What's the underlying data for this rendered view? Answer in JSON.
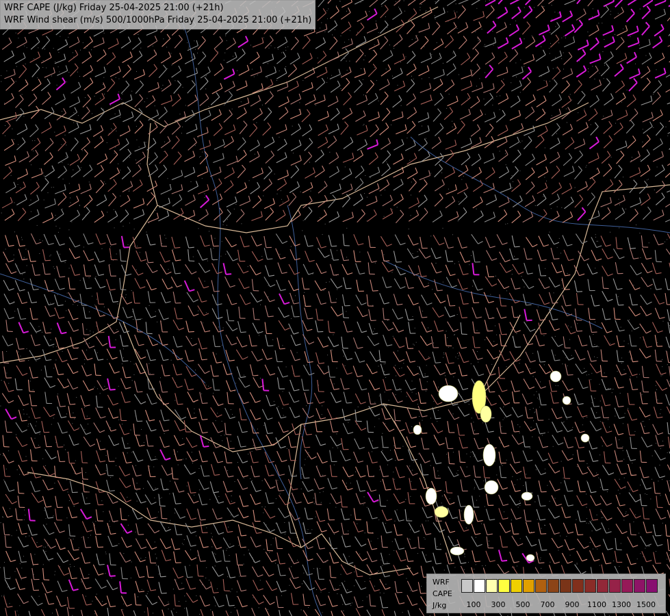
{
  "title": {
    "line1": "WRF CAPE (J/kg) Friday 25-04-2025 21:00 (+21h)",
    "line2": "WRF Wind shear (m/s) 500/1000hPa Friday 25-04-2025 21:00 (+21h)"
  },
  "legend": {
    "label_line1": "WRF",
    "label_line2": "CAPE",
    "label_line3": "J/kg",
    "colors": [
      "#c8c8c8",
      "#ffffff",
      "#ffffb0",
      "#ffff40",
      "#f0d000",
      "#e0a000",
      "#b06010",
      "#8c4418",
      "#7a3418",
      "#82301c",
      "#8a2c28",
      "#922838",
      "#962248",
      "#961a58",
      "#8e1466",
      "#880e70"
    ],
    "ticks": [
      "100",
      "300",
      "500",
      "700",
      "900",
      "1100",
      "1300",
      "1500"
    ]
  }
}
